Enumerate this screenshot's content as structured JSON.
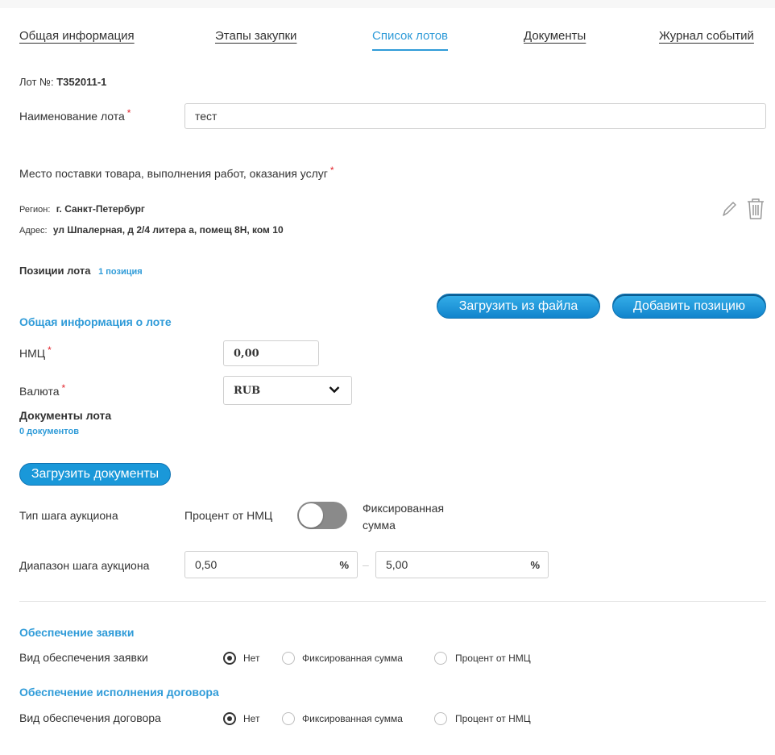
{
  "tabs": [
    {
      "label": "Общая информация"
    },
    {
      "label": "Этапы закупки"
    },
    {
      "label": "Список лотов"
    },
    {
      "label": "Документы"
    },
    {
      "label": "Журнал событий"
    }
  ],
  "lot": {
    "number_label": "Лот №:",
    "number_value": "Т352011-1",
    "name_label": "Наименование лота",
    "name_value": "тест"
  },
  "delivery": {
    "title": "Место поставки товара, выполнения работ, оказания услуг",
    "region_label": "Регион:",
    "region_value": "г. Санкт-Петербург",
    "address_label": "Адрес:",
    "address_value": "ул Шпалерная, д 2/4 литера а, помещ 8Н, ком 10"
  },
  "positions": {
    "title": "Позиции лота",
    "count": "1 позиция",
    "upload_button": "Загрузить из файла",
    "add_button": "Добавить позицию"
  },
  "general": {
    "title": "Общая информация о лоте",
    "nmc_label": "НМЦ",
    "nmc_value": "0,00",
    "currency_label": "Валюта",
    "currency_value": "RUB"
  },
  "documents": {
    "title": "Документы лота",
    "count": "0 документов",
    "upload_button": "Загрузить документы"
  },
  "auction": {
    "step_type_label": "Тип шага аукциона",
    "step_type_left": "Процент от НМЦ",
    "step_type_right_line1": "Фиксированная",
    "step_type_right_line2": "сумма",
    "range_label": "Диапазон шага аукциона",
    "range_from": "0,50",
    "range_to": "5,00",
    "range_unit": "%",
    "range_separator": "–"
  },
  "application_security": {
    "title": "Обеспечение заявки",
    "label": "Вид обеспечения заявки",
    "options": [
      "Нет",
      "Фиксированная сумма",
      "Процент от НМЦ"
    ],
    "selected": "Нет"
  },
  "contract_security": {
    "title": "Обеспечение исполнения договора",
    "label": "Вид обеспечения договора",
    "options": [
      "Нет",
      "Фиксированная сумма",
      "Процент от НМЦ"
    ],
    "selected": "Нет"
  },
  "colors": {
    "accent": "#2f9bd8",
    "required": "#e2232b",
    "button": "#1a98d9"
  }
}
